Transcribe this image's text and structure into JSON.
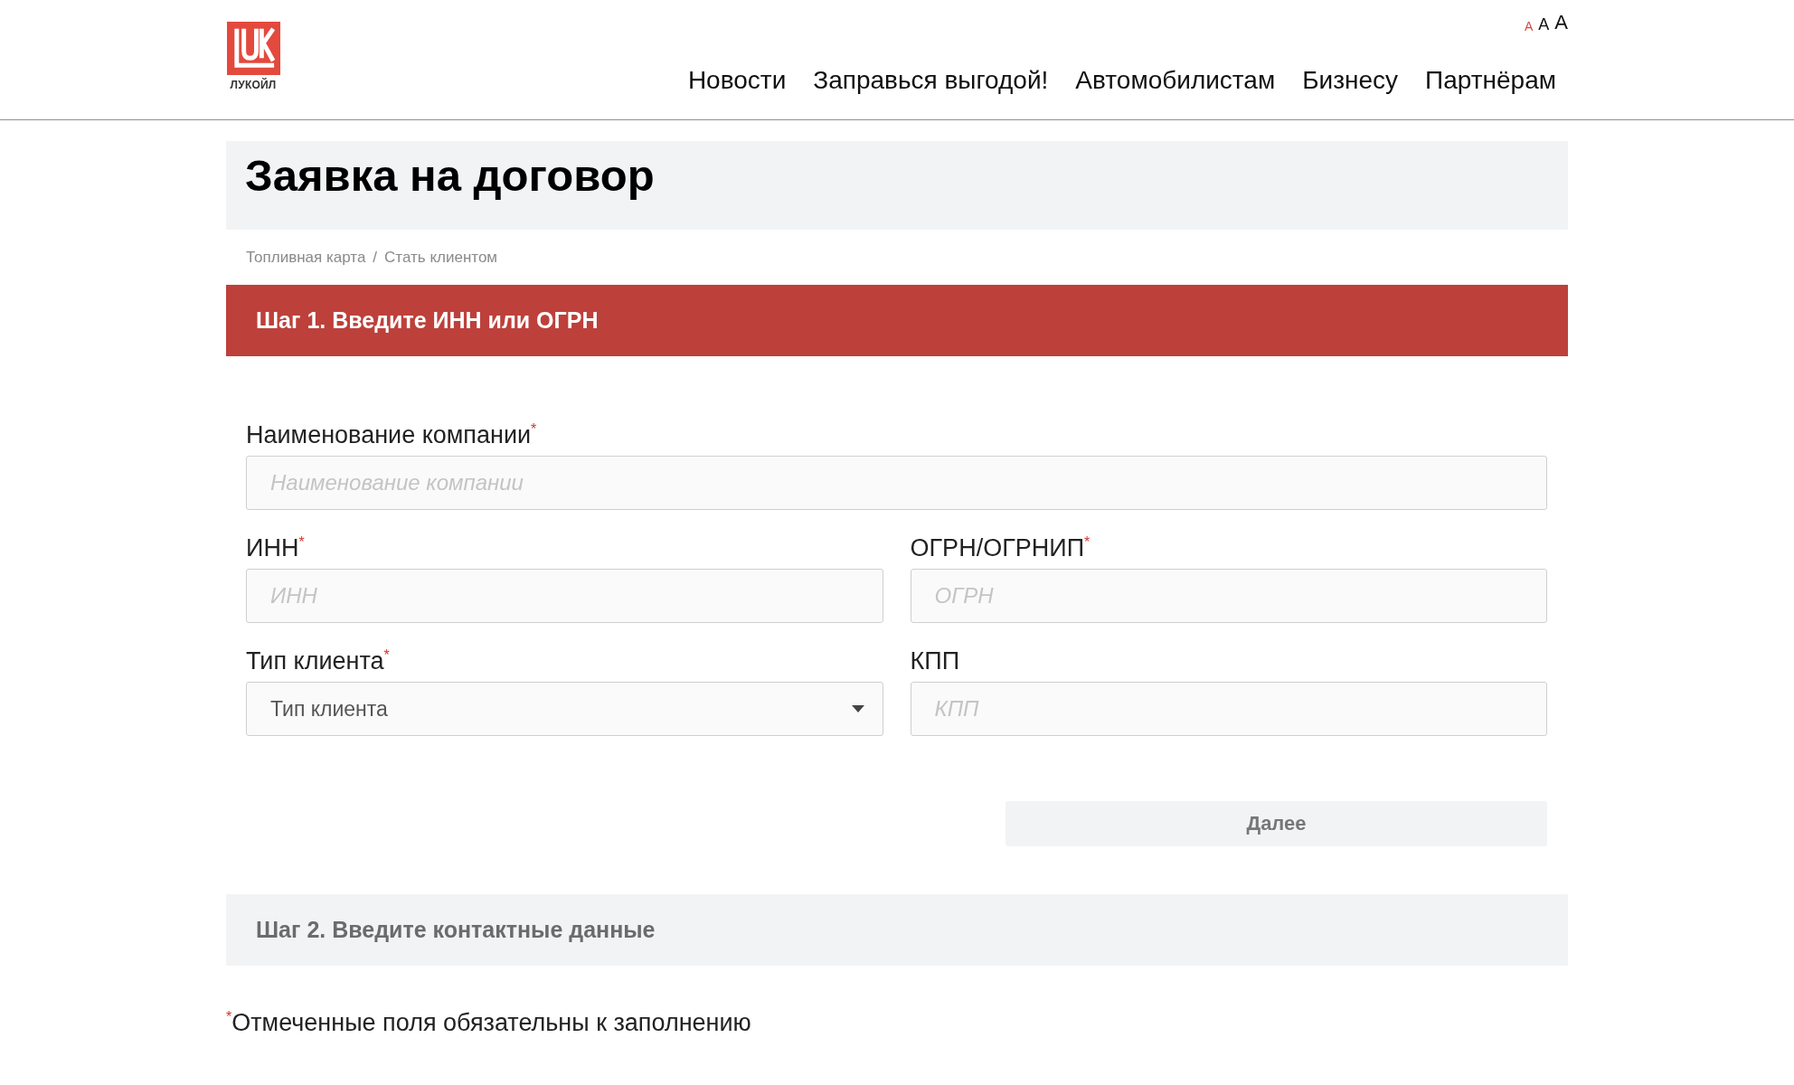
{
  "header": {
    "logo": {
      "text": "ЛУКОЙЛ"
    },
    "font_sizes": [
      {
        "label": "A",
        "selected": true
      },
      {
        "label": "A",
        "selected": false
      },
      {
        "label": "A",
        "selected": false
      }
    ],
    "nav": [
      "Новости",
      "Заправься выгодой!",
      "Автомобилистам",
      "Бизнесу",
      "Партнёрам"
    ]
  },
  "page_title": "Заявка на договор",
  "breadcrumb": {
    "items": [
      "Топливная карта",
      "Стать клиентом"
    ],
    "separator": "/"
  },
  "steps": [
    {
      "title": "Шаг 1. Введите ИНН или ОГРН",
      "active": true,
      "rows": [
        {
          "fields": [
            {
              "kind": "text",
              "label": "Наименование компании",
              "mark": "*",
              "placeholder": "Наименование компании"
            }
          ]
        },
        {
          "fields": [
            {
              "kind": "text",
              "label": "ИНН",
              "mark": "*",
              "placeholder": "ИНН"
            },
            {
              "kind": "text",
              "label": "ОГРН/ОГРНИП",
              "mark": "*",
              "placeholder": "ОГРН"
            }
          ]
        },
        {
          "fields": [
            {
              "kind": "select",
              "label": "Тип клиента",
              "mark": "*",
              "value": "Тип клиента"
            },
            {
              "kind": "text",
              "label": "КПП",
              "placeholder": "КПП"
            }
          ]
        }
      ],
      "submit": {
        "label": "Далее",
        "disabled": true
      }
    },
    {
      "title": "Шаг 2. Введите контактные данные",
      "active": false
    }
  ],
  "footnote": {
    "mark": "*",
    "text": "Отмеченные поля обязательны к заполнению"
  }
}
